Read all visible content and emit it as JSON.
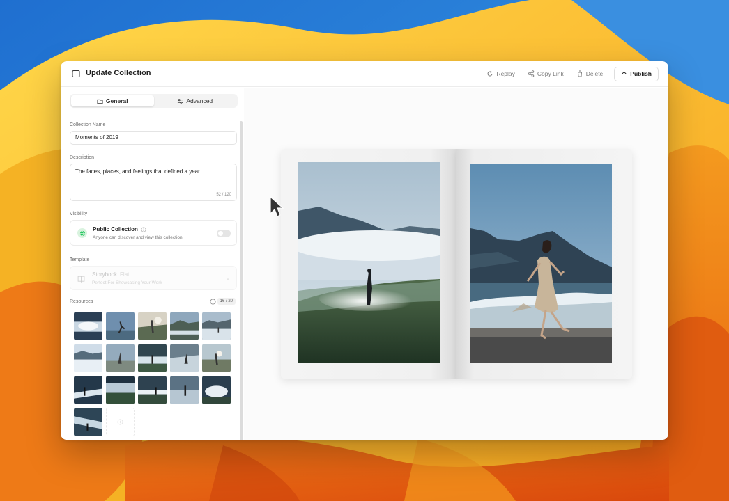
{
  "window": {
    "title": "Update Collection",
    "actions": {
      "replay": "Replay",
      "copy_link": "Copy Link",
      "delete": "Delete",
      "publish": "Publish"
    }
  },
  "tabs": [
    {
      "label": "General",
      "icon": "folder-icon",
      "active": true
    },
    {
      "label": "Advanced",
      "icon": "sliders-icon",
      "active": false
    }
  ],
  "form": {
    "name_label": "Collection Name",
    "name_value": "Moments of 2019",
    "description_label": "Description",
    "description_value": "The faces, places, and feelings that defined a year.",
    "description_counter": "52 / 120",
    "visibility_label": "Visibility",
    "visibility": {
      "title": "Public Collection",
      "subtitle": "Anyone can discover and view this collection",
      "enabled": false
    },
    "template_label": "Template",
    "template": {
      "name": "Storybook",
      "variant": "Flat",
      "subtitle": "Perfect For Showcasing Your Work"
    },
    "resources_label": "Resources",
    "resources_count": "16 / 20"
  },
  "colors": {
    "accent_green": "#22c55e",
    "window_bg": "#ffffff"
  }
}
